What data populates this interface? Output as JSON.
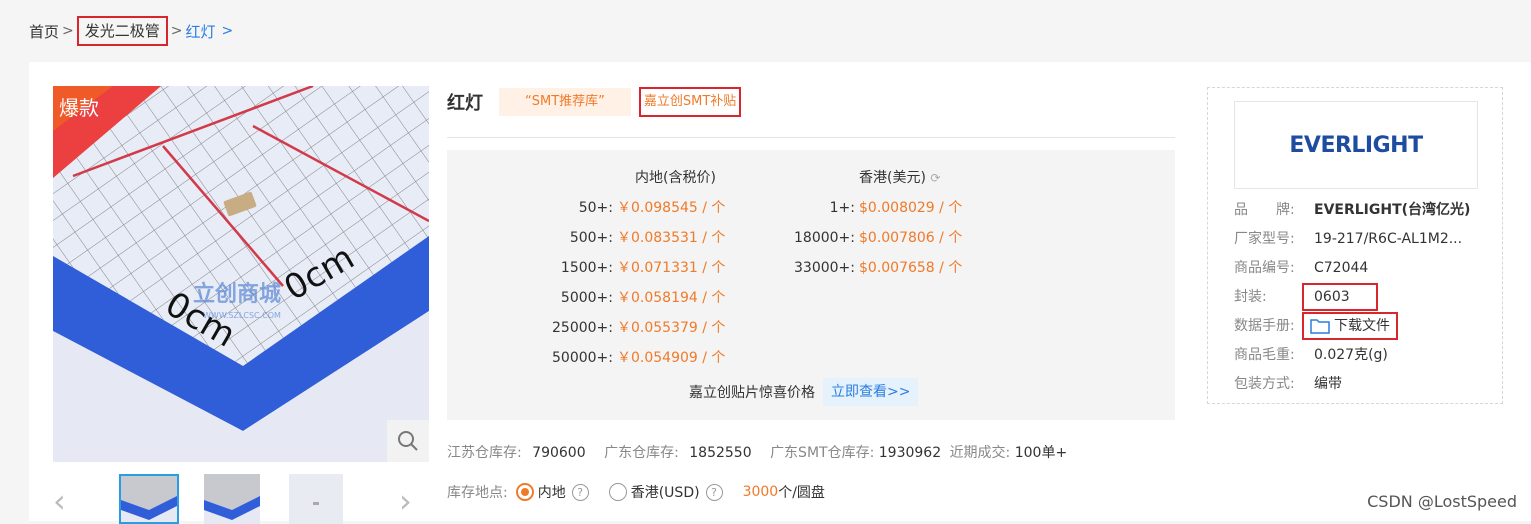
{
  "breadcrumb": {
    "home": "首页",
    "category": "发光二极管",
    "current": "红灯",
    "sep": ">"
  },
  "product": {
    "badge": "爆款",
    "title": "红灯",
    "tag_smt": "“SMT推荐库”",
    "tag_subsidy": "嘉立创SMT补贴",
    "image_watermark": "立创商城",
    "image_watermark_url": "WWW.SZLCSC.COM"
  },
  "prices": {
    "mainland_header": "内地(含税价)",
    "hk_header": "香港(美元)",
    "mainland": [
      {
        "qty": "50+:",
        "price": "￥0.098545 / 个"
      },
      {
        "qty": "500+:",
        "price": "￥0.083531 / 个"
      },
      {
        "qty": "1500+:",
        "price": "￥0.071331 / 个"
      },
      {
        "qty": "5000+:",
        "price": "￥0.058194 / 个"
      },
      {
        "qty": "25000+:",
        "price": "￥0.055379 / 个"
      },
      {
        "qty": "50000+:",
        "price": "￥0.054909 / 个"
      }
    ],
    "hk": [
      {
        "qty": "1+:",
        "price": "$0.008029 / 个"
      },
      {
        "qty": "18000+:",
        "price": "$0.007806 / 个"
      },
      {
        "qty": "33000+:",
        "price": "$0.007658 / 个"
      }
    ],
    "promo_text": "嘉立创贴片惊喜价格",
    "promo_link": "立即查看>>"
  },
  "stock": {
    "jiangsu_label": "江苏仓库存:",
    "jiangsu_value": "790600",
    "guangdong_label": "广东仓库存:",
    "guangdong_value": "1852550",
    "smt_label": "广东SMT仓库存:",
    "smt_value": "1930962",
    "recent_label": "近期成交:",
    "recent_value": "100单+"
  },
  "location": {
    "label": "库存地点:",
    "option_mainland": "内地",
    "option_hk": "香港(USD)",
    "reel_qty": "3000",
    "reel_unit": "个/圆盘"
  },
  "brand_box": {
    "logo_text": "EVERLIGHT",
    "attrs": [
      {
        "key": "品　　牌:",
        "value": "EVERLIGHT(台湾亿光)"
      },
      {
        "key": "厂家型号:",
        "value": "19-217/R6C-AL1M2..."
      },
      {
        "key": "商品编号:",
        "value": "C72044"
      },
      {
        "key": "封装:",
        "value": "0603"
      },
      {
        "key": "数据手册:",
        "value": "下载文件"
      },
      {
        "key": "商品毛重:",
        "value": "0.027克(g)"
      },
      {
        "key": "包装方式:",
        "value": "编带"
      }
    ]
  },
  "watermark": "CSDN @LostSpeed"
}
